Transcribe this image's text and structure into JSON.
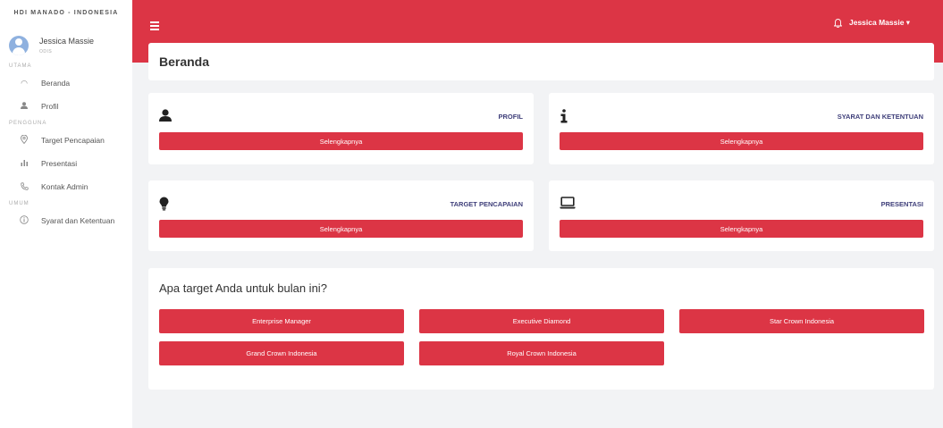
{
  "brand": "HDI MANADO - INDONESIA",
  "user": {
    "name": "Jessica Massie",
    "role": "ODIS"
  },
  "sidebar": {
    "sections": [
      {
        "title": "UTAMA",
        "items": [
          {
            "label": "Beranda",
            "icon": "dashboard-icon"
          },
          {
            "label": "Profil",
            "icon": "user-icon"
          }
        ]
      },
      {
        "title": "PENGGUNA",
        "items": [
          {
            "label": "Target Pencapaian",
            "icon": "map-pin-icon"
          },
          {
            "label": "Presentasi",
            "icon": "bar-chart-icon"
          },
          {
            "label": "Kontak Admin",
            "icon": "phone-icon"
          }
        ]
      },
      {
        "title": "UMUM",
        "items": [
          {
            "label": "Syarat dan Ketentuan",
            "icon": "info-circle-icon"
          }
        ]
      }
    ]
  },
  "topbar": {
    "user_label": "Jessica Massie ▾",
    "accent": "#dc3545"
  },
  "page": {
    "title": "Beranda"
  },
  "cards": [
    {
      "label": "PROFIL",
      "button": "Selengkapnya",
      "icon": "user-icon"
    },
    {
      "label": "SYARAT DAN KETENTUAN",
      "button": "Selengkapnya",
      "icon": "info-icon"
    },
    {
      "label": "TARGET PENCAPAIAN",
      "button": "Selengkapnya",
      "icon": "lightbulb-icon"
    },
    {
      "label": "PRESENTASI",
      "button": "Selengkapnya",
      "icon": "laptop-icon"
    }
  ],
  "targets": {
    "title": "Apa target Anda untuk bulan ini?",
    "options": [
      "Enterprise Manager",
      "Executive Diamond",
      "Star Crown Indonesia",
      "Grand Crown Indonesia",
      "Royal Crown Indonesia"
    ]
  }
}
